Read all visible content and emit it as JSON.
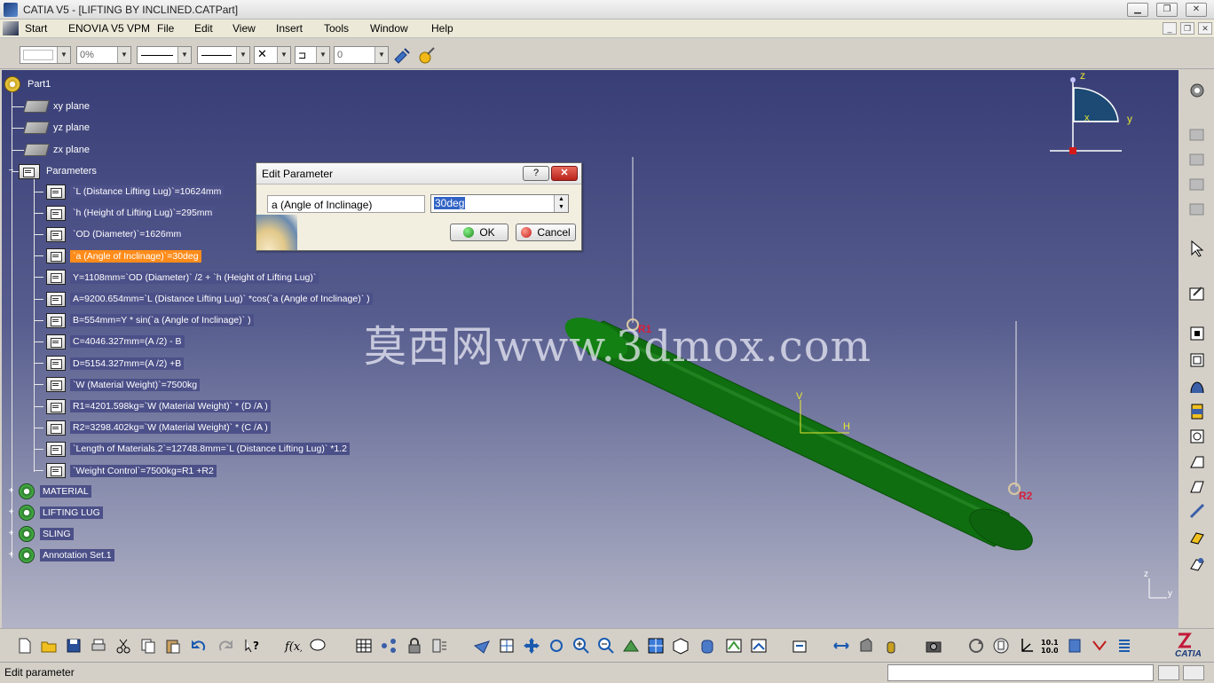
{
  "window": {
    "title": "CATIA V5 - [LIFTING BY INCLINED.CATPart]",
    "minimize_icon": "minimize-icon",
    "maximize_icon": "restore-icon",
    "close_icon": "close-icon"
  },
  "menubar": {
    "items": [
      "Start",
      "ENOVIA V5 VPM",
      "File",
      "Edit",
      "View",
      "Insert",
      "Tools",
      "Window",
      "Help"
    ]
  },
  "props_toolbar": {
    "color_value": "",
    "transparency_value": "0%",
    "layer_value": "0"
  },
  "tree": {
    "root": "Part1",
    "planes": [
      "xy plane",
      "yz plane",
      "zx plane"
    ],
    "parameters_label": "Parameters",
    "parameters": [
      "`L (Distance Lifting Lug)`=10624mm",
      "`h (Height of Lifting Lug)`=295mm",
      "`OD (Diameter)`=1626mm",
      "`a (Angle of Inclinage)`=30deg",
      "Y=1108mm=`OD (Diameter)` /2 + `h (Height of Lifting Lug)`",
      "A=9200.654mm=`L (Distance Lifting Lug)` *cos(`a (Angle of Inclinage)` )",
      "B=554mm=Y * sin(`a (Angle of Inclinage)` )",
      "C=4046.327mm=(A /2) - B",
      "D=5154.327mm=(A /2) +B",
      "`W (Material Weight)`=7500kg",
      "R1=4201.598kg=`W (Material Weight)` * (D /A )",
      "R2=3298.402kg=`W (Material Weight)` * (C /A )",
      "`Length of Materials.2`=12748.8mm=`L (Distance Lifting Lug)` *1.2",
      "`Weight Control`=7500kg=R1 +R2"
    ],
    "selected_parameter_index": 3,
    "bodies": [
      "MATERIAL",
      "LIFTING LUG",
      "SLING",
      "Annotation Set.1"
    ]
  },
  "dialog": {
    "title": "Edit Parameter",
    "param_name": "a (Angle of Inclinage)",
    "param_value": "30deg",
    "ok_label": "OK",
    "cancel_label": "Cancel",
    "help_icon": "help-icon",
    "close_icon": "close-icon"
  },
  "viewport": {
    "watermark": "莫西网www.3dmox.com",
    "labels": {
      "r1": "R1",
      "r2": "R2",
      "v": "V",
      "h": "H"
    },
    "compass": {
      "z": "z",
      "y": "y",
      "x": "x"
    },
    "mini_axis": {
      "z": "z",
      "y": "y"
    }
  },
  "colors": {
    "viewport_top": "#383e76",
    "viewport_bottom": "#b3b4c6",
    "cylinder": "#0f6e0f",
    "selection": "#ff8c1a",
    "marker": "#c8102e"
  },
  "status": {
    "text": "Edit parameter",
    "brand": "CATIA"
  }
}
